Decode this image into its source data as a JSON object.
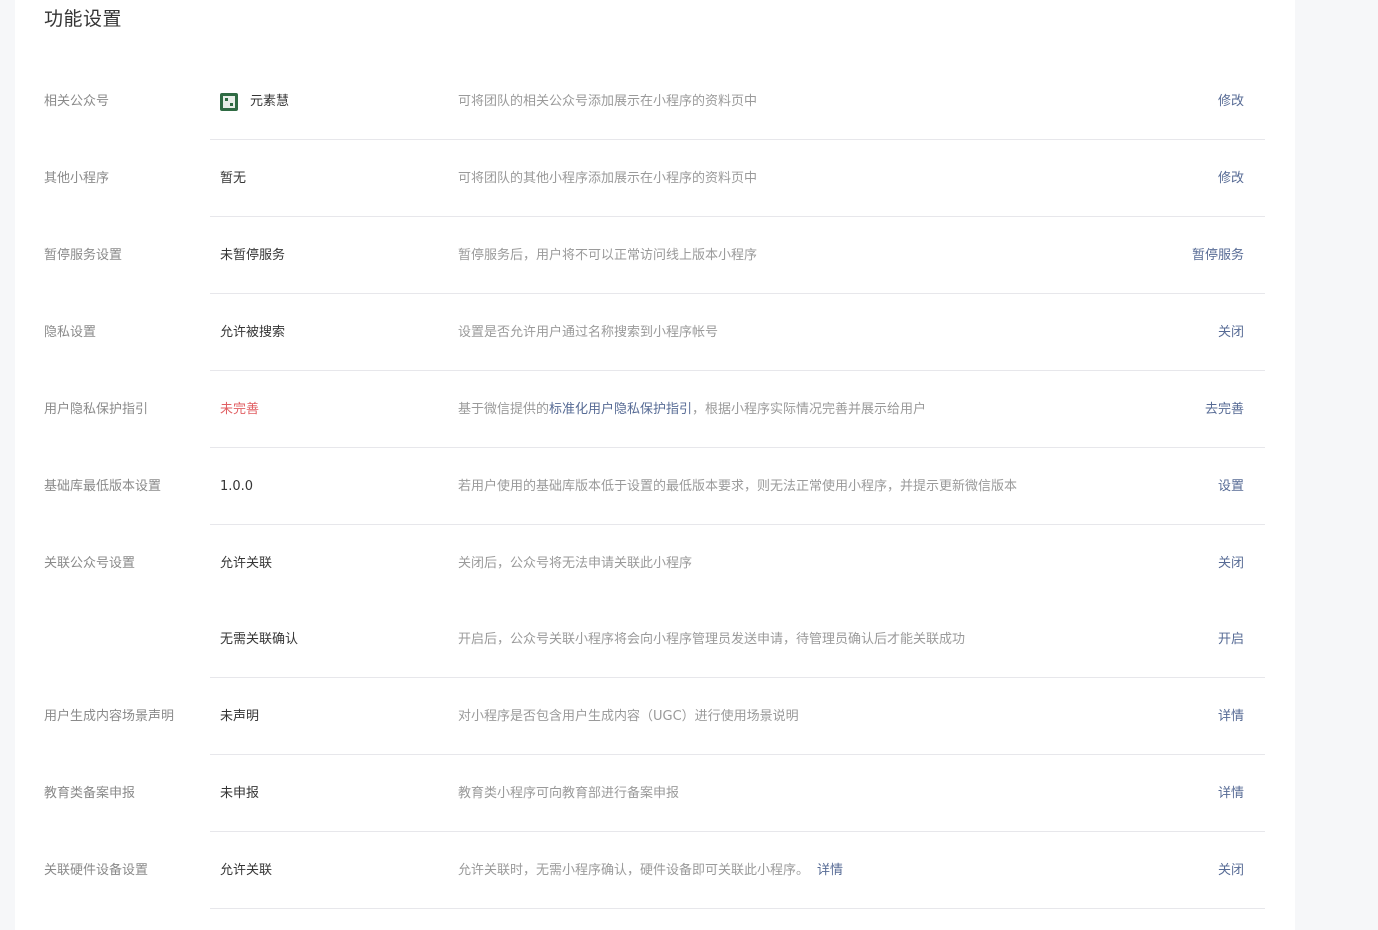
{
  "page": {
    "title": "功能设置"
  },
  "rows": [
    {
      "label": "相关公众号",
      "value": "元素慧",
      "desc": "可将团队的相关公众号添加展示在小程序的资料页中",
      "action": "修改"
    },
    {
      "label": "其他小程序",
      "value": "暂无",
      "desc": "可将团队的其他小程序添加展示在小程序的资料页中",
      "action": "修改"
    },
    {
      "label": "暂停服务设置",
      "value": "未暂停服务",
      "desc": "暂停服务后，用户将不可以正常访问线上版本小程序",
      "action": "暂停服务"
    },
    {
      "label": "隐私设置",
      "value": "允许被搜索",
      "desc": "设置是否允许用户通过名称搜索到小程序帐号",
      "action": "关闭"
    },
    {
      "label": "用户隐私保护指引",
      "value": "未完善",
      "desc_prefix": "基于微信提供的",
      "desc_link": "标准化用户隐私保护指引",
      "desc_suffix": "，根据小程序实际情况完善并展示给用户",
      "action": "去完善"
    },
    {
      "label": "基础库最低版本设置",
      "value": "1.0.0",
      "desc": "若用户使用的基础库版本低于设置的最低版本要求，则无法正常使用小程序，并提示更新微信版本",
      "action": "设置"
    },
    {
      "label": "关联公众号设置",
      "value": "允许关联",
      "desc": "关闭后，公众号将无法申请关联此小程序",
      "action": "关闭"
    },
    {
      "label": "",
      "value": "无需关联确认",
      "desc": "开启后，公众号关联小程序将会向小程序管理员发送申请，待管理员确认后才能关联成功",
      "action": "开启"
    },
    {
      "label": "用户生成内容场景声明",
      "value": "未声明",
      "desc": "对小程序是否包含用户生成内容（UGC）进行使用场景说明",
      "action": "详情"
    },
    {
      "label": "教育类备案申报",
      "value": "未申报",
      "desc": "教育类小程序可向教育部进行备案申报",
      "action": "详情"
    },
    {
      "label": "关联硬件设备设置",
      "value": "允许关联",
      "desc": "允许关联时，无需小程序确认，硬件设备即可关联此小程序。",
      "desc_link": "详情",
      "action": "关闭"
    }
  ],
  "colors": {
    "link": "#576b95",
    "warning": "#e15f63",
    "label": "#8a8a8a",
    "desc": "#9a9a9a",
    "divider": "#e7e7eb"
  }
}
